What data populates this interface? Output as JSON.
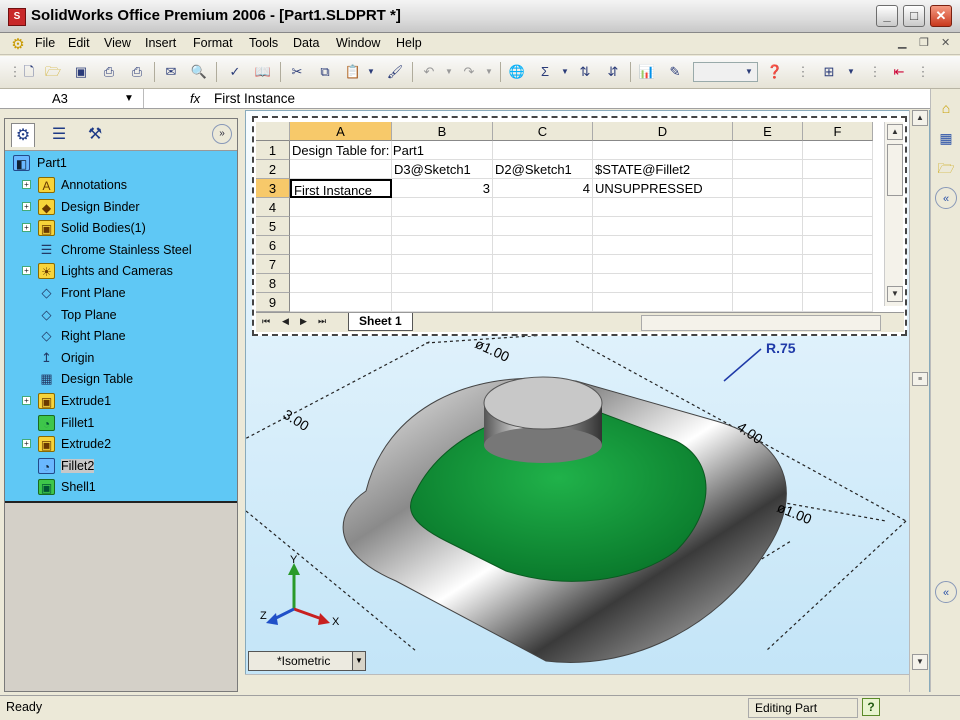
{
  "window": {
    "title": "SolidWorks Office Premium 2006 - [Part1.SLDPRT *]",
    "min": "_",
    "max": "□",
    "close": "✕"
  },
  "menu": [
    "File",
    "Edit",
    "View",
    "Insert",
    "Format",
    "Tools",
    "Data",
    "Window",
    "Help"
  ],
  "formula_bar": {
    "cell_ref": "A3",
    "fx": "fx",
    "value": "First Instance"
  },
  "feature_tree": {
    "root": "Part1",
    "items": [
      {
        "label": "Annotations",
        "expandable": true
      },
      {
        "label": "Design Binder",
        "expandable": true
      },
      {
        "label": "Solid Bodies(1)",
        "expandable": true
      },
      {
        "label": "Chrome Stainless Steel",
        "expandable": false
      },
      {
        "label": "Lights and Cameras",
        "expandable": true
      },
      {
        "label": "Front Plane",
        "expandable": false
      },
      {
        "label": "Top Plane",
        "expandable": false
      },
      {
        "label": "Right Plane",
        "expandable": false
      },
      {
        "label": "Origin",
        "expandable": false
      },
      {
        "label": "Design Table",
        "expandable": false
      },
      {
        "label": "Extrude1",
        "expandable": true
      },
      {
        "label": "Fillet1",
        "expandable": false
      },
      {
        "label": "Extrude2",
        "expandable": true
      },
      {
        "label": "Fillet2",
        "expandable": false
      },
      {
        "label": "Shell1",
        "expandable": false
      }
    ]
  },
  "sheet": {
    "columns": [
      "A",
      "B",
      "C",
      "D",
      "E",
      "F"
    ],
    "rows": [
      "1",
      "2",
      "3",
      "4",
      "5",
      "6",
      "7",
      "8",
      "9"
    ],
    "cells": {
      "A1": "Design Table for:  Part1",
      "B2": "D3@Sketch1",
      "C2": "D2@Sketch1",
      "D2": "$STATE@Fillet2",
      "A3": "First Instance",
      "B3": "3",
      "C3": "4",
      "D3": "UNSUPPRESSED"
    },
    "tab": "Sheet 1"
  },
  "viewport": {
    "dims": {
      "d1": "ø1.00",
      "r": "R.75",
      "d3": "3.00",
      "d4": "4.00",
      "d5": "ø1.00"
    },
    "axes": {
      "x": "X",
      "y": "Y",
      "z": "Z"
    },
    "view_orientation": "*Isometric"
  },
  "status": {
    "text": "Ready",
    "mode": "Editing Part",
    "help": "?"
  },
  "colors": {
    "tree_bg": "#5fc8f5",
    "green_face": "#139a3a"
  }
}
